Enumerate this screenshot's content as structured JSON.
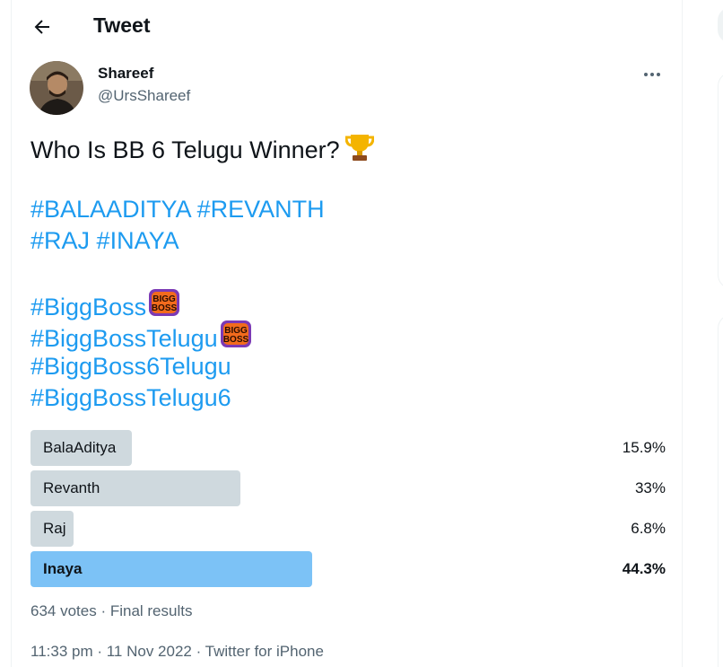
{
  "header": {
    "title": "Tweet"
  },
  "author": {
    "name": "Shareef",
    "handle": "@UrsShareef"
  },
  "tweet": {
    "question": "Who Is BB 6 Telugu Winner?",
    "hashtags_line1": [
      "#BALAADITYA",
      "#REVANTH"
    ],
    "hashtags_line2": [
      "#RAJ",
      "#INAYA"
    ],
    "hashtags_line3": [
      "#BiggBoss"
    ],
    "hashtags_line4": [
      "#BiggBossTelugu"
    ],
    "hashtags_line5": [
      "#BiggBoss6Telugu"
    ],
    "hashtags_line6": [
      "#BiggBossTelugu6"
    ],
    "badge_text": [
      "BIGG",
      "BOSS"
    ]
  },
  "poll": {
    "options": [
      {
        "label": "BalaAditya",
        "percent_text": "15.9%",
        "percent": 15.9,
        "winner": false
      },
      {
        "label": "Revanth",
        "percent_text": "33%",
        "percent": 33,
        "winner": false
      },
      {
        "label": "Raj",
        "percent_text": "6.8%",
        "percent": 6.8,
        "winner": false
      },
      {
        "label": "Inaya",
        "percent_text": "44.3%",
        "percent": 44.3,
        "winner": true
      }
    ],
    "meta": "634 votes · Final results"
  },
  "timestamp": "11:33 pm · 11 Nov 2022 · Twitter for iPhone",
  "colors": {
    "accent": "#1d9bf0",
    "poll_bar": "#cfd9de",
    "poll_winner": "#7cc2f6",
    "secondary_text": "#536471"
  },
  "icons": {
    "back": "arrow-left-icon",
    "more": "more-horizontal-icon",
    "trophy": "trophy-emoji",
    "badge": "bigg-boss-emoji"
  }
}
